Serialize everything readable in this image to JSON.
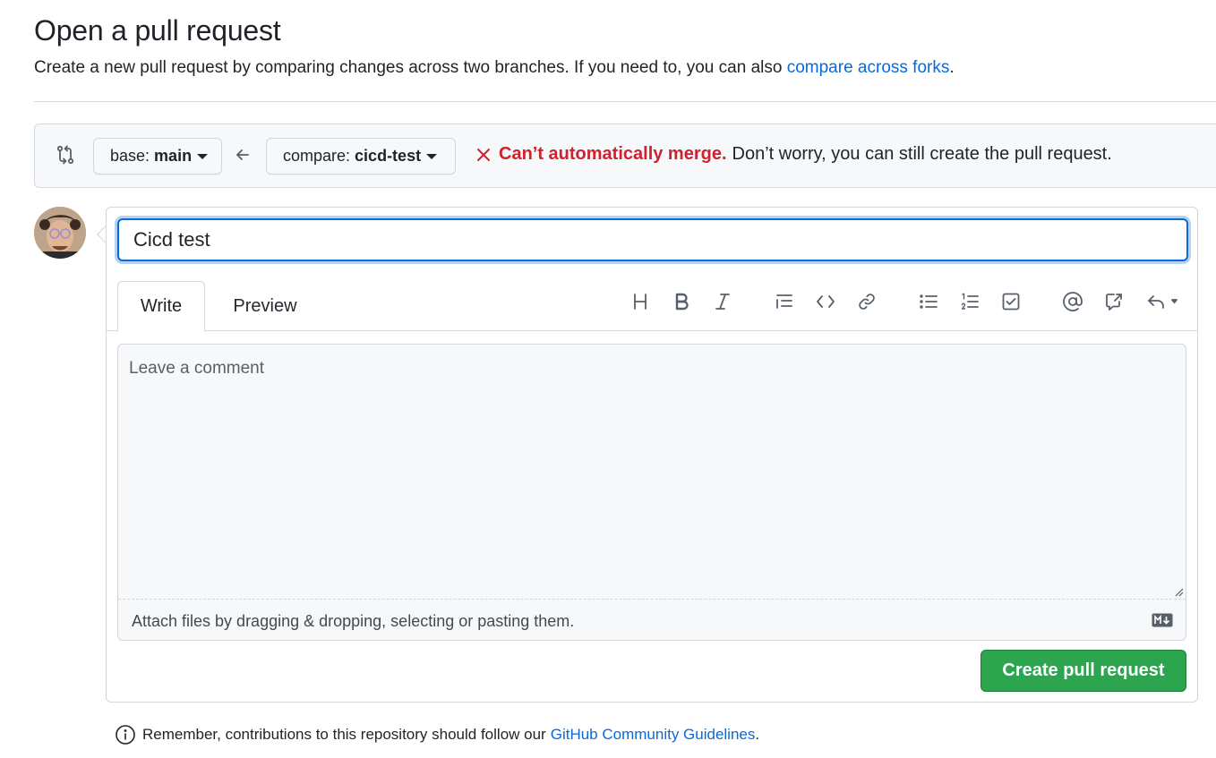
{
  "header": {
    "title": "Open a pull request",
    "subtitle": "Create a new pull request by comparing changes across two branches. If you need to, you can also",
    "subtitle_link": "compare across forks",
    "subtitle_end": "."
  },
  "compare": {
    "base_prefix": "base:",
    "base_branch": "main",
    "compare_prefix": "compare:",
    "compare_branch": "cicd-test",
    "merge_status_bold": "Can’t automatically merge.",
    "merge_status_rest": "Don’t worry, you can still create the pull request."
  },
  "form": {
    "title_value": "Cicd test",
    "tabs": [
      {
        "label": "Write",
        "active": true
      },
      {
        "label": "Preview",
        "active": false
      }
    ],
    "toolbar": [
      "heading-icon",
      "bold-icon",
      "italic-icon",
      "quote-icon",
      "code-icon",
      "link-icon",
      "unordered-list-icon",
      "ordered-list-icon",
      "task-list-icon",
      "mention-icon",
      "cross-reference-icon",
      "saved-replies-icon"
    ],
    "comment_placeholder": "Leave a comment",
    "attach_text": "Attach files by dragging & dropping, selecting or pasting them.",
    "submit_label": "Create pull request"
  },
  "footer": {
    "note": "Remember, contributions to this repository should follow our",
    "link": "GitHub Community Guidelines",
    "end": "."
  },
  "colors": {
    "accent": "#0969da",
    "danger": "#cf222e",
    "success": "#2da44e"
  }
}
